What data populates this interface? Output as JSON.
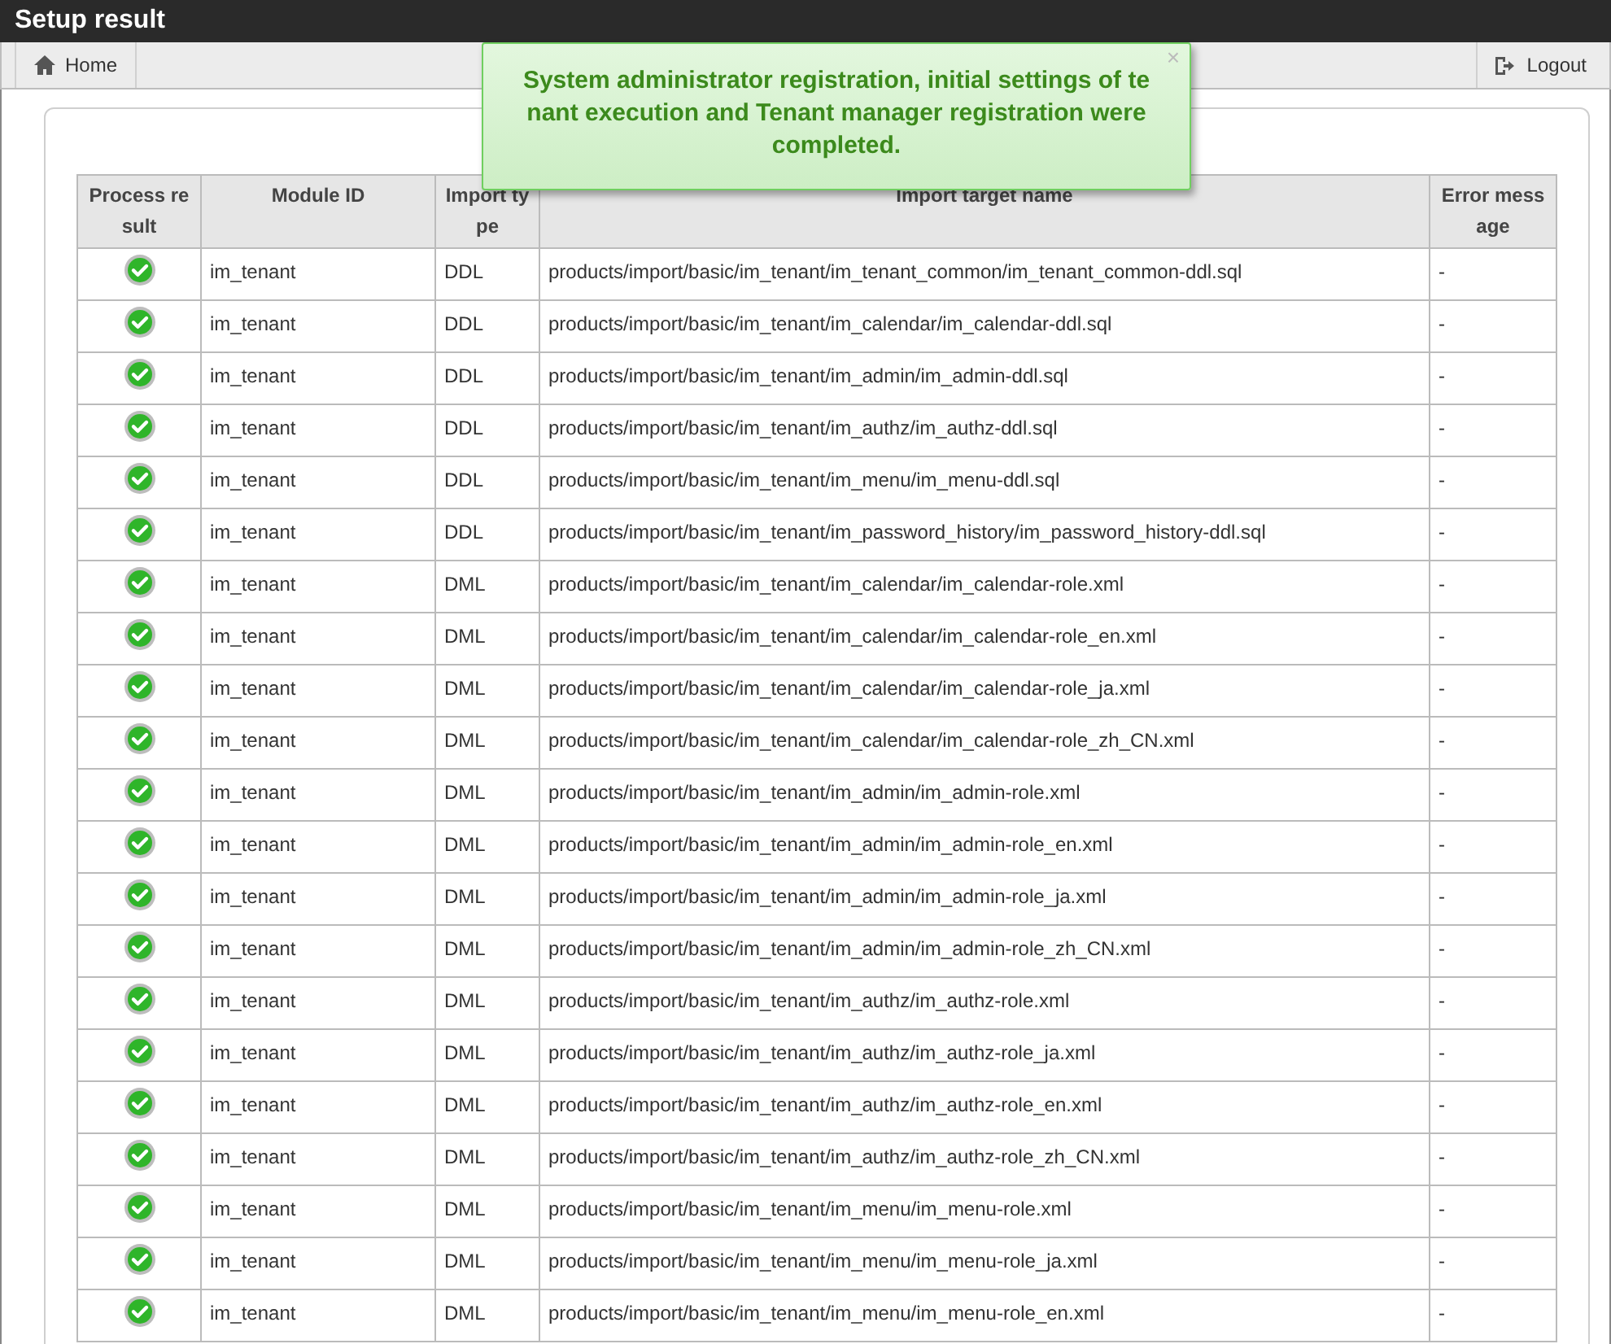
{
  "window": {
    "title": "Setup result"
  },
  "toolbar": {
    "home": "Home",
    "logout": "Logout"
  },
  "toast": {
    "message": "System administrator registration, initial settings of tenant execution and Tenant manager registration were completed.",
    "close": "×"
  },
  "table": {
    "columns": [
      "Process result",
      "Module ID",
      "Import type",
      "Import target name",
      "Error message"
    ],
    "rows": [
      {
        "kind": "success",
        "module_id": "im_tenant",
        "import_type": "DDL",
        "target": "products/import/basic/im_tenant/im_tenant_common/im_tenant_common-ddl.sql",
        "error": "-"
      },
      {
        "kind": "success",
        "module_id": "im_tenant",
        "import_type": "DDL",
        "target": "products/import/basic/im_tenant/im_calendar/im_calendar-ddl.sql",
        "error": "-"
      },
      {
        "kind": "success",
        "module_id": "im_tenant",
        "import_type": "DDL",
        "target": "products/import/basic/im_tenant/im_admin/im_admin-ddl.sql",
        "error": "-"
      },
      {
        "kind": "success",
        "module_id": "im_tenant",
        "import_type": "DDL",
        "target": "products/import/basic/im_tenant/im_authz/im_authz-ddl.sql",
        "error": "-"
      },
      {
        "kind": "success",
        "module_id": "im_tenant",
        "import_type": "DDL",
        "target": "products/import/basic/im_tenant/im_menu/im_menu-ddl.sql",
        "error": "-"
      },
      {
        "kind": "success",
        "module_id": "im_tenant",
        "import_type": "DDL",
        "target": "products/import/basic/im_tenant/im_password_history/im_password_history-ddl.sql",
        "error": "-"
      },
      {
        "kind": "success",
        "module_id": "im_tenant",
        "import_type": "DML",
        "target": "products/import/basic/im_tenant/im_calendar/im_calendar-role.xml",
        "error": "-"
      },
      {
        "kind": "success",
        "module_id": "im_tenant",
        "import_type": "DML",
        "target": "products/import/basic/im_tenant/im_calendar/im_calendar-role_en.xml",
        "error": "-"
      },
      {
        "kind": "success",
        "module_id": "im_tenant",
        "import_type": "DML",
        "target": "products/import/basic/im_tenant/im_calendar/im_calendar-role_ja.xml",
        "error": "-"
      },
      {
        "kind": "success",
        "module_id": "im_tenant",
        "import_type": "DML",
        "target": "products/import/basic/im_tenant/im_calendar/im_calendar-role_zh_CN.xml",
        "error": "-"
      },
      {
        "kind": "success",
        "module_id": "im_tenant",
        "import_type": "DML",
        "target": "products/import/basic/im_tenant/im_admin/im_admin-role.xml",
        "error": "-"
      },
      {
        "kind": "success",
        "module_id": "im_tenant",
        "import_type": "DML",
        "target": "products/import/basic/im_tenant/im_admin/im_admin-role_en.xml",
        "error": "-"
      },
      {
        "kind": "success",
        "module_id": "im_tenant",
        "import_type": "DML",
        "target": "products/import/basic/im_tenant/im_admin/im_admin-role_ja.xml",
        "error": "-"
      },
      {
        "kind": "success",
        "module_id": "im_tenant",
        "import_type": "DML",
        "target": "products/import/basic/im_tenant/im_admin/im_admin-role_zh_CN.xml",
        "error": "-"
      },
      {
        "kind": "success",
        "module_id": "im_tenant",
        "import_type": "DML",
        "target": "products/import/basic/im_tenant/im_authz/im_authz-role.xml",
        "error": "-"
      },
      {
        "kind": "success",
        "module_id": "im_tenant",
        "import_type": "DML",
        "target": "products/import/basic/im_tenant/im_authz/im_authz-role_ja.xml",
        "error": "-"
      },
      {
        "kind": "success",
        "module_id": "im_tenant",
        "import_type": "DML",
        "target": "products/import/basic/im_tenant/im_authz/im_authz-role_en.xml",
        "error": "-"
      },
      {
        "kind": "success",
        "module_id": "im_tenant",
        "import_type": "DML",
        "target": "products/import/basic/im_tenant/im_authz/im_authz-role_zh_CN.xml",
        "error": "-"
      },
      {
        "kind": "success",
        "module_id": "im_tenant",
        "import_type": "DML",
        "target": "products/import/basic/im_tenant/im_menu/im_menu-role.xml",
        "error": "-"
      },
      {
        "kind": "success",
        "module_id": "im_tenant",
        "import_type": "DML",
        "target": "products/import/basic/im_tenant/im_menu/im_menu-role_ja.xml",
        "error": "-"
      },
      {
        "kind": "success",
        "module_id": "im_tenant",
        "import_type": "DML",
        "target": "products/import/basic/im_tenant/im_menu/im_menu-role_en.xml",
        "error": "-"
      }
    ]
  }
}
